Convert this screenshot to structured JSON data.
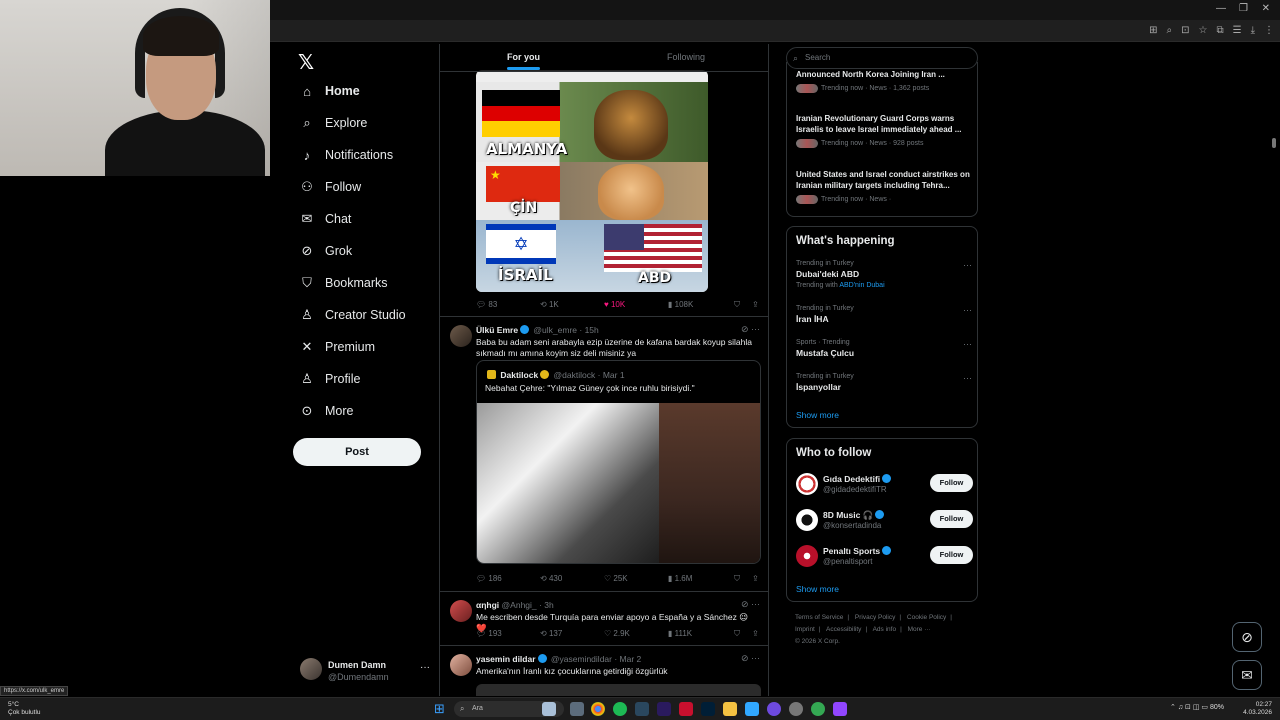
{
  "nav": {
    "items": [
      {
        "label": "Home",
        "icon": "home-icon",
        "glyph": "⌂"
      },
      {
        "label": "Explore",
        "icon": "search-icon",
        "glyph": "⌕"
      },
      {
        "label": "Notifications",
        "icon": "bell-icon",
        "glyph": "🔔︎"
      },
      {
        "label": "Follow",
        "icon": "person-plus-icon",
        "glyph": "⚇"
      },
      {
        "label": "Chat",
        "icon": "envelope-icon",
        "glyph": "✉"
      },
      {
        "label": "Grok",
        "icon": "grok-icon",
        "glyph": "⊘"
      },
      {
        "label": "Bookmarks",
        "icon": "bookmark-icon",
        "glyph": "⛉"
      },
      {
        "label": "Creator Studio",
        "icon": "creator-icon",
        "glyph": "♙"
      },
      {
        "label": "Premium",
        "icon": "x-icon",
        "glyph": "✕"
      },
      {
        "label": "Profile",
        "icon": "person-icon",
        "glyph": "♙"
      },
      {
        "label": "More",
        "icon": "more-circle-icon",
        "glyph": "⋯"
      }
    ],
    "post_label": "Post",
    "account": {
      "name": "Dumen Damn",
      "handle": "@Dumendamn",
      "menu": "···"
    }
  },
  "timeline": {
    "tab_foryou": "For you",
    "tab_following": "Following",
    "flag_post": {
      "labels": {
        "de": "ALMANYA",
        "cn": "ÇİN",
        "il": "İSRAİL",
        "us": "ABD"
      },
      "replies": "83",
      "reposts": "1K",
      "likes": "10K",
      "views": "108K",
      "liked": true
    },
    "tweet1": {
      "name": "Ülkü Emre",
      "handle": "@ulk_emre",
      "time": "· 15h",
      "text": "Baba bu adam seni arabayla ezip üzerine de kafana bardak koyup silahla sıkmadı mı amına koyim siz deli misiniz ya",
      "quote": {
        "name": "Daktilock",
        "handle": "@daktilock",
        "time": "· Mar 1",
        "text": "Nebahat Çehre: \"Yılmaz Güney çok ince ruhlu birisiydi.\""
      },
      "replies": "186",
      "reposts": "430",
      "likes": "25K",
      "views": "1.6M"
    },
    "tweet2": {
      "name": "αηhgi",
      "handle": "@Anhgi_",
      "time": "· 3h",
      "text": "Me escriben desde Turquía para enviar apoyo a España y a Sánchez 😉❤️",
      "replies": "193",
      "reposts": "137",
      "likes": "2.9K",
      "views": "111K"
    },
    "tweet3": {
      "name": "yasemin dildar",
      "handle": "@yasemindildar",
      "time": "· Mar 2",
      "text": "Amerika'nın İranlı kız çocuklarına getirdiği özgürlük"
    }
  },
  "sidebar": {
    "search_placeholder": "Search",
    "news": [
      {
        "title": "Announced North Korea Joining Iran ...",
        "meta": "Trending now · News · 1,362 posts"
      },
      {
        "title": "Iranian Revolutionary Guard Corps warns Israelis to leave Israel immediately ahead ...",
        "meta": "Trending now · News · 928 posts"
      },
      {
        "title": "United States and Israel conduct airstrikes on Iranian military targets including Tehra...",
        "meta": "Trending now · News ·"
      }
    ],
    "happening_title": "What's happening",
    "trends": [
      {
        "context": "Trending in Turkey",
        "name": "Dubai'deki ABD",
        "sub_prefix": "Trending with",
        "sub_link": "ABD'nin Dubai"
      },
      {
        "context": "Trending in Turkey",
        "name": "İran İHA"
      },
      {
        "context": "Sports · Trending",
        "name": "Mustafa Çulcu"
      },
      {
        "context": "Trending in Turkey",
        "name": "İspanyollar"
      }
    ],
    "show_more": "Show more",
    "wtf_title": "Who to follow",
    "follow": [
      {
        "name": "Gıda Dedektifi",
        "handle": "@gidadedektifiTR",
        "button": "Follow"
      },
      {
        "name": "8D Music 🎧",
        "handle": "@konsertadinda",
        "button": "Follow"
      },
      {
        "name": "Penaltı Sports",
        "handle": "@penaltisport",
        "button": "Follow"
      }
    ],
    "footer": {
      "links": [
        "Terms of Service",
        "|",
        "Privacy Policy",
        "|",
        "Cookie Policy",
        "|",
        "Imprint",
        "|",
        "Accessibility",
        "|",
        "Ads info",
        "|",
        "More ···"
      ],
      "copyright": "© 2026 X Corp."
    }
  },
  "status_url": "https://x.com/ulk_emre",
  "taskbar": {
    "weather_temp": "5°C",
    "weather_desc": "Çok bulutlu",
    "search_label": "Ara",
    "battery": "80%",
    "time": "02:27",
    "date": "4.03.2026"
  },
  "colors": {
    "accent": "#1d9bf0",
    "like": "#f91880",
    "bg": "#000000",
    "border": "#2f3336",
    "muted": "#71767b"
  }
}
